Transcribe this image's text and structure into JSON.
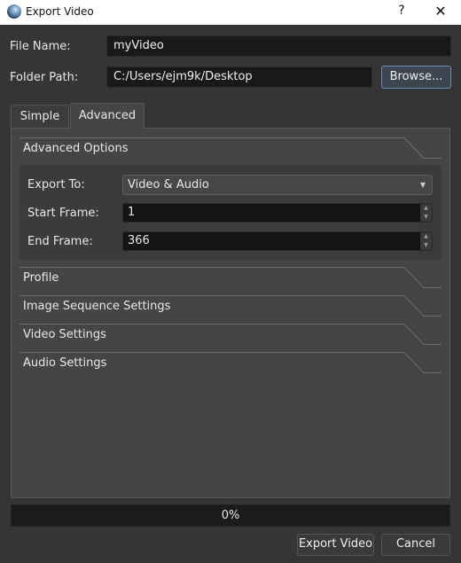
{
  "window": {
    "title": "Export Video",
    "help": "?",
    "close": "✕"
  },
  "form": {
    "file_name_label": "File Name:",
    "file_name": "myVideo",
    "folder_label": "Folder Path:",
    "folder": "C:/Users/ejm9k/Desktop",
    "browse": "Browse..."
  },
  "tabs": [
    {
      "label": "Simple",
      "active": false
    },
    {
      "label": "Advanced",
      "active": true
    }
  ],
  "advanced": {
    "section_title": "Advanced Options",
    "export_to_label": "Export To:",
    "export_to": "Video & Audio",
    "start_frame_label": "Start Frame:",
    "start_frame": "1",
    "end_frame_label": "End Frame:",
    "end_frame": "366",
    "sections": [
      "Profile",
      "Image Sequence Settings",
      "Video Settings",
      "Audio Settings"
    ]
  },
  "progress": {
    "value": 0,
    "text": "0%"
  },
  "buttons": {
    "export": "Export Video",
    "cancel": "Cancel"
  }
}
